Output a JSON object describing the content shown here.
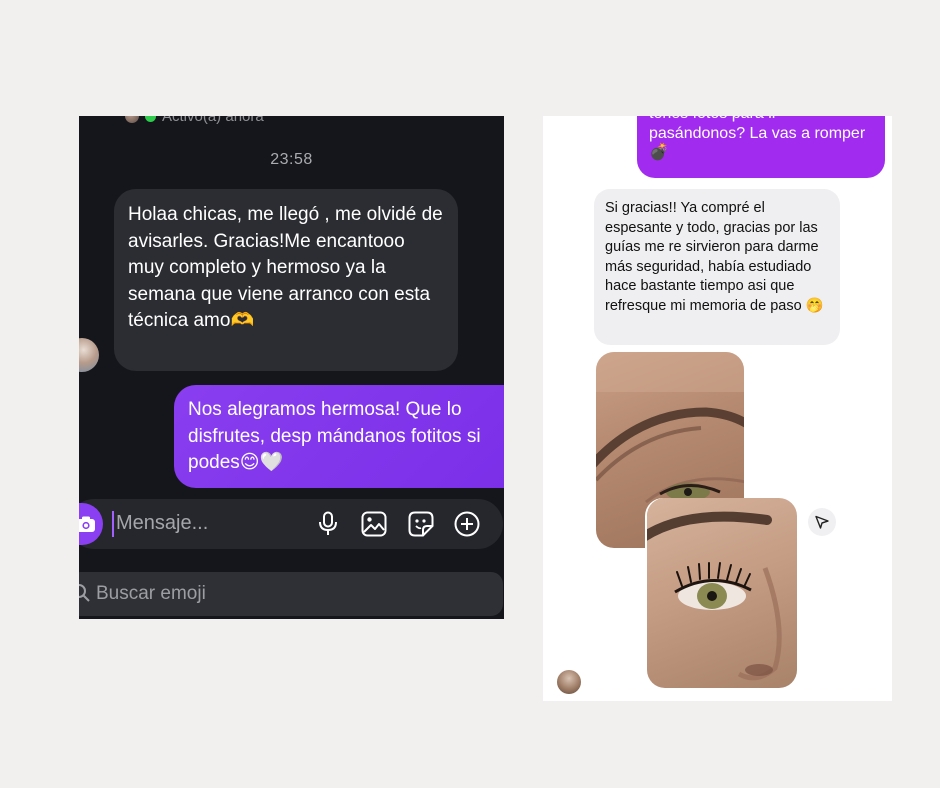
{
  "left_chat": {
    "status_text": "Activo(a) ahora",
    "timestamp": "23:58",
    "incoming_message": "Holaa chicas, me llegó , me olvidé de avisarles. Gracias!Me encantooo muy completo y hermoso ya la semana que viene arranco con esta técnica amo🫶",
    "outgoing_message": "Nos alegramos hermosa! Que lo disfrutes, desp mándanos fotitos si podes😊🤍",
    "composer_placeholder": "Mensaje...",
    "emoji_search_placeholder": "Buscar emoji",
    "colors": {
      "background": "#14161b",
      "incoming_bubble": "#2b2d32",
      "outgoing_bubble": "#8a3ef0",
      "online": "#2fcb4c"
    },
    "icons": [
      "camera-icon",
      "microphone-icon",
      "gallery-icon",
      "sticker-icon",
      "plus-icon",
      "search-icon"
    ]
  },
  "right_chat": {
    "outgoing_message": "tenes fotos para ir pasándonos? La vas a romper 💣",
    "incoming_message": "Si gracias!! Ya compré el espesante y todo, gracias por las guías me re sirvieron para darme más seguridad, había estudiado hace bastante tiempo asi que refresque mi memoria de paso 🤭",
    "colors": {
      "background": "#ffffff",
      "incoming_bubble": "#efeff1",
      "outgoing_bubble": "#a12cf0"
    },
    "icons": [
      "share-icon"
    ]
  }
}
